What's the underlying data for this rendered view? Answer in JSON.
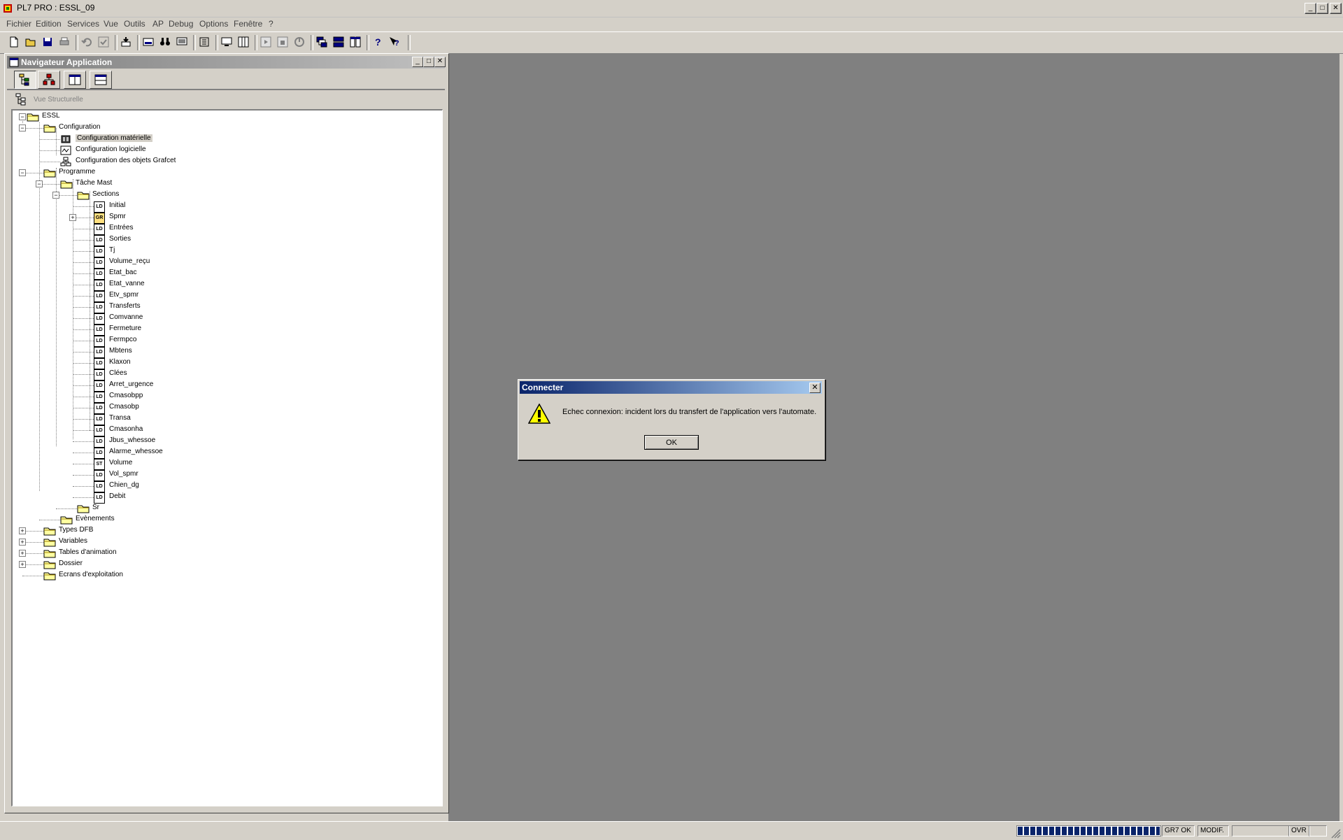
{
  "window": {
    "title": "PL7 PRO : ESSL_09",
    "minimize": "_",
    "maximize": "□",
    "close": "✕"
  },
  "menu": [
    "Fichier",
    "Edition",
    "Services",
    "Vue",
    "Outils",
    "AP",
    "Debug",
    "Options",
    "Fenêtre",
    "?"
  ],
  "toolbar": {
    "icons": [
      "new-file-icon",
      "open-folder-icon",
      "save-icon",
      "print-icon",
      "undo-icon",
      "validate-icon",
      "transfer-icon",
      "edit-icon",
      "binoculars-icon",
      "screen-icon",
      "config-icon",
      "monitor-icon",
      "columns-icon",
      "run-icon",
      "stop-icon",
      "init-icon",
      "cascade-icon",
      "tile-horizontal-icon",
      "tile-vertical-icon",
      "help-icon",
      "context-help-icon"
    ]
  },
  "navigator": {
    "title": "Navigateur Application",
    "view_label": "Vue Structurelle",
    "tree": {
      "root": "ESSL",
      "configuration": "Configuration",
      "config_items": [
        "Configuration matérielle",
        "Configuration logicielle",
        "Configuration des objets Grafcet"
      ],
      "programme": "Programme",
      "tache": "Tâche Mast",
      "sections_folder": "Sections",
      "sections": [
        {
          "type": "LD",
          "label": "Initial"
        },
        {
          "type": "GR",
          "label": "Spmr"
        },
        {
          "type": "LD",
          "label": "Entrées"
        },
        {
          "type": "LD",
          "label": "Sorties"
        },
        {
          "type": "LD",
          "label": "Tj"
        },
        {
          "type": "LD",
          "label": "Volume_reçu"
        },
        {
          "type": "LD",
          "label": "Etat_bac"
        },
        {
          "type": "LD",
          "label": "Etat_vanne"
        },
        {
          "type": "LD",
          "label": "Etv_spmr"
        },
        {
          "type": "LD",
          "label": "Transferts"
        },
        {
          "type": "LD",
          "label": "Comvanne"
        },
        {
          "type": "LD",
          "label": "Fermeture"
        },
        {
          "type": "LD",
          "label": "Fermpco"
        },
        {
          "type": "LD",
          "label": "Mbtens"
        },
        {
          "type": "LD",
          "label": "Klaxon"
        },
        {
          "type": "LD",
          "label": "Clées"
        },
        {
          "type": "LD",
          "label": "Arret_urgence"
        },
        {
          "type": "LD",
          "label": "Cmasobpp"
        },
        {
          "type": "LD",
          "label": "Cmasobp"
        },
        {
          "type": "LD",
          "label": "Transa"
        },
        {
          "type": "LD",
          "label": "Cmasonha"
        },
        {
          "type": "LD",
          "label": "Jbus_whessoe"
        },
        {
          "type": "LD",
          "label": "Alarme_whessoe"
        },
        {
          "type": "ST",
          "label": "Volume"
        },
        {
          "type": "LD",
          "label": "Vol_spmr"
        },
        {
          "type": "LD",
          "label": "Chien_dg"
        },
        {
          "type": "LD",
          "label": "Debit"
        }
      ],
      "sr": "Sr",
      "evenements": "Evènements",
      "bottom_folders": [
        "Types DFB",
        "Variables",
        "Tables d'animation",
        "Dossier",
        "Ecrans d'exploitation"
      ]
    }
  },
  "dialog": {
    "title": "Connecter",
    "message": "Echec connexion: incident  lors du transfert de l'application vers l'automate.",
    "ok": "OK",
    "close": "✕"
  },
  "statusbar": {
    "progress": 1.0,
    "gr7": "GR7 OK",
    "modif": "MODIF.",
    "empty": "",
    "ovr": "OVR"
  }
}
